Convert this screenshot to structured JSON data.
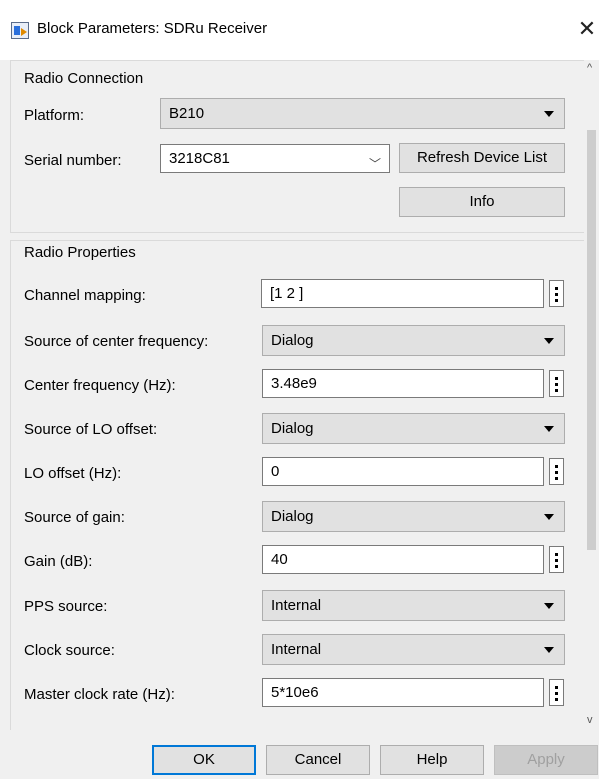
{
  "window": {
    "title": "Block Parameters: SDRu Receiver",
    "close_glyph": "✕"
  },
  "radio_connection": {
    "title": "Radio Connection",
    "platform_label": "Platform:",
    "platform_value": "B210",
    "serial_label": "Serial number:",
    "serial_value": "3218C81",
    "refresh_label": "Refresh Device List",
    "info_label": "Info"
  },
  "radio_properties": {
    "title": "Radio Properties",
    "channel_mapping_label": "Channel mapping:",
    "channel_mapping_value": "[1 2 ]",
    "source_center_freq_label": "Source of center frequency:",
    "source_center_freq_value": "Dialog",
    "center_freq_label": "Center frequency (Hz):",
    "center_freq_value": "3.48e9",
    "source_lo_offset_label": "Source of LO offset:",
    "source_lo_offset_value": "Dialog",
    "lo_offset_label": "LO offset (Hz):",
    "lo_offset_value": "0",
    "source_gain_label": "Source of gain:",
    "source_gain_value": "Dialog",
    "gain_label": "Gain (dB):",
    "gain_value": "40",
    "pps_source_label": "PPS source:",
    "pps_source_value": "Internal",
    "clock_source_label": "Clock source:",
    "clock_source_value": "Internal",
    "master_clock_label": "Master clock rate (Hz):",
    "master_clock_value": "5*10e6"
  },
  "footer": {
    "ok_label": "OK",
    "cancel_label": "Cancel",
    "help_label": "Help",
    "apply_label": "Apply"
  },
  "colors": {
    "accent": "#0078d7",
    "panel_bg": "#f0f0f0",
    "button_bg": "#e1e1e1"
  },
  "icons": {
    "app": "simulink-block-icon",
    "close": "close-icon",
    "dropdown": "caret-down-icon",
    "ellipsis": "vertical-ellipsis-icon"
  }
}
